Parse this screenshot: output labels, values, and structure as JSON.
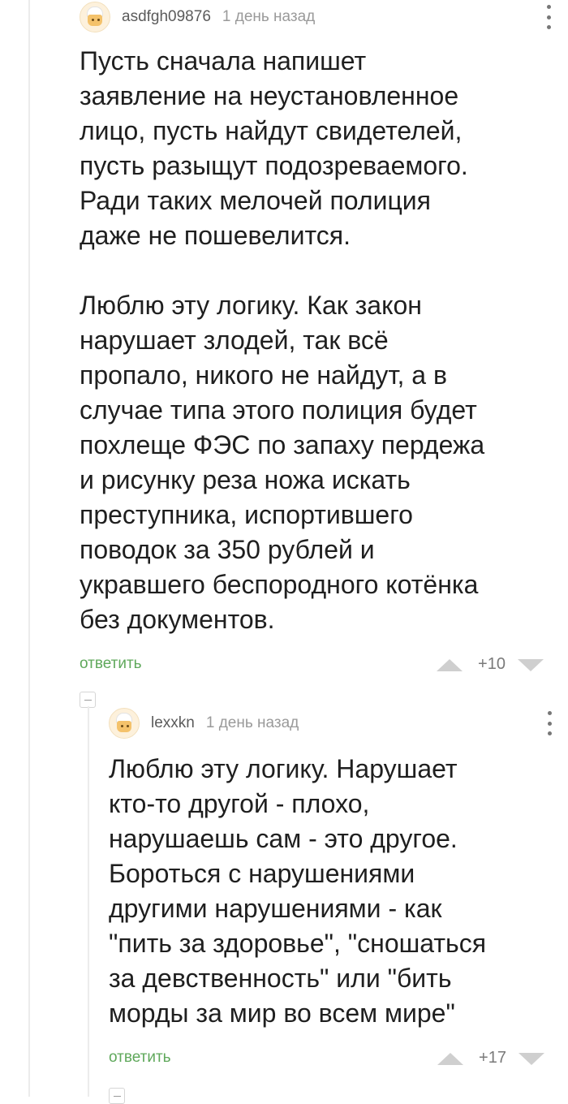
{
  "comments": [
    {
      "username": "asdfgh09876",
      "time": "1 день назад",
      "text": "Пусть сначала напишет\nзаявление на неустановленное\nлицо, пусть найдут свидетелей,\nпусть разыщут подозреваемого.\nРади таких мелочей полиция\nдаже не пошевелится.\n\nЛюблю эту логику. Как закон\nнарушает злодей, так всё\nпропало, никого не найдут, а в\nслучае типа этого полиция будет\nпохлеще ФЭС по запаху пердежа\nи рисунку реза ножа искать\nпреступника, испортившего\nповодок за 350 рублей и\nукравшего беспородного котёнка\nбез документов.",
      "reply_label": "ответить",
      "rating": "+10"
    },
    {
      "username": "lexxkn",
      "time": "1 день назад",
      "text": "Люблю эту логику. Нарушает\nкто-то другой - плохо,\nнарушаешь сам - это другое.\nБороться с нарушениями\nдругими нарушениями - как\n\"пить за здоровье\", \"сношаться\nза девственность\" или \"бить\nморды за мир во всем мире\"",
      "reply_label": "ответить",
      "rating": "+17"
    }
  ]
}
